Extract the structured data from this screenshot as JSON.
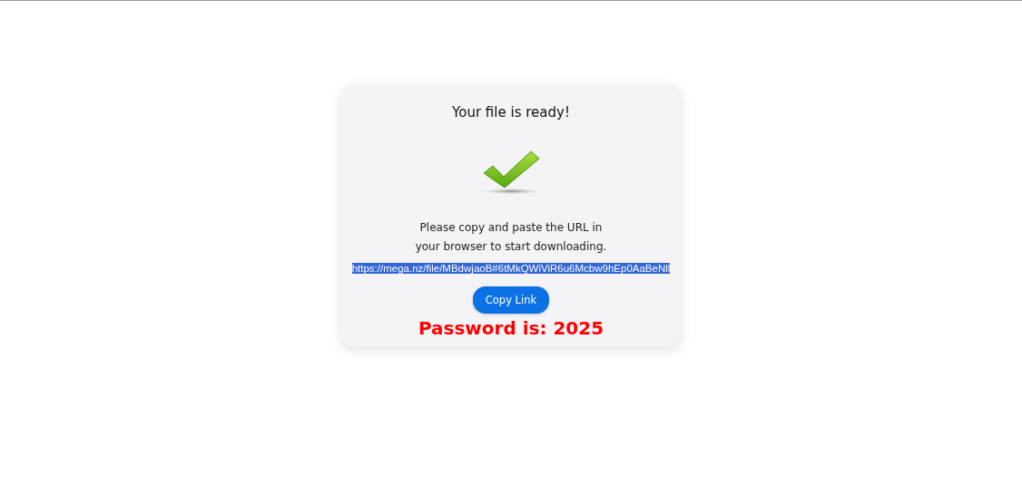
{
  "card": {
    "title": "Your file is ready!",
    "instructions": [
      "Please copy and paste the URL in",
      "your browser to start downloading."
    ],
    "url_field": {
      "value": "https://mega.nz/file/MBdwjaoB#6tMkQWiViR6u6Mcbw9hEp0AaBeNll",
      "selected": true
    },
    "copy_button": "Copy Link",
    "password": "Password is: 2025"
  }
}
